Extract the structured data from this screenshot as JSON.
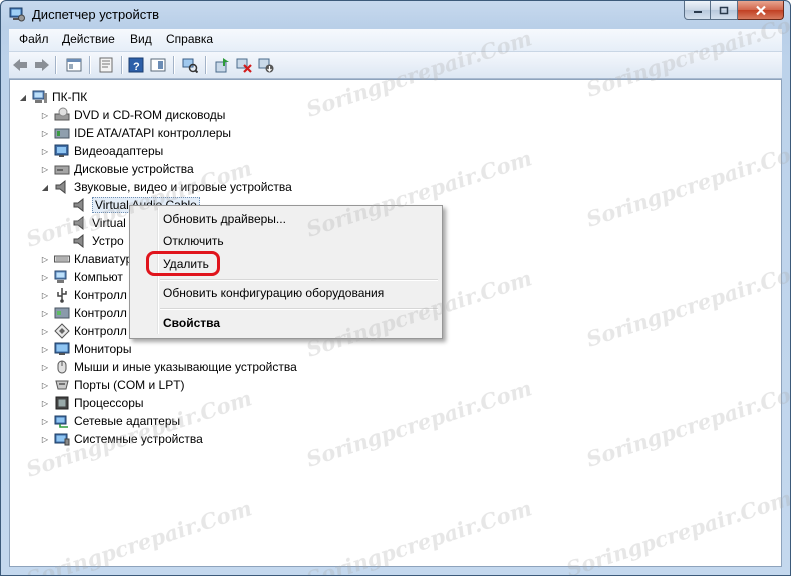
{
  "window": {
    "title": "Диспетчер устройств"
  },
  "menu": [
    "Файл",
    "Действие",
    "Вид",
    "Справка"
  ],
  "tree": {
    "root": "ПК-ПК",
    "categories": [
      {
        "label": "DVD и CD-ROM дисководы",
        "icon": "dvd-drive-icon"
      },
      {
        "label": "IDE ATA/ATAPI контроллеры",
        "icon": "ide-controller-icon"
      },
      {
        "label": "Видеоадаптеры",
        "icon": "display-adapter-icon"
      },
      {
        "label": "Дисковые устройства",
        "icon": "disk-drive-icon"
      },
      {
        "label": "Звуковые, видео и игровые устройства",
        "icon": "speaker-icon",
        "expanded": true,
        "children": [
          "Virtual Audio Cable",
          "Virtual",
          "Устро"
        ]
      },
      {
        "label": "Клавиатур",
        "icon": "keyboard-icon"
      },
      {
        "label": "Компьют",
        "icon": "computer-icon"
      },
      {
        "label": "Контролл",
        "icon": "usb-controller-icon"
      },
      {
        "label": "Контролл",
        "icon": "storage-controller-icon"
      },
      {
        "label": "Контролл",
        "icon": "controller-icon"
      },
      {
        "label": "Мониторы",
        "icon": "monitor-icon"
      },
      {
        "label": "Мыши и иные указывающие устройства",
        "icon": "mouse-icon"
      },
      {
        "label": "Порты (COM и LPT)",
        "icon": "port-icon"
      },
      {
        "label": "Процессоры",
        "icon": "processor-icon"
      },
      {
        "label": "Сетевые адаптеры",
        "icon": "network-adapter-icon"
      },
      {
        "label": "Системные устройства",
        "icon": "system-device-icon"
      }
    ]
  },
  "context_menu": {
    "update": "Обновить драйверы...",
    "disable": "Отключить",
    "uninstall": "Удалить",
    "scan": "Обновить конфигурацию оборудования",
    "properties": "Свойства"
  },
  "watermark": "Soringpcrepair.Com",
  "colors": {
    "highlight": "#e0141c",
    "title_bar": "#b9cfe8"
  }
}
